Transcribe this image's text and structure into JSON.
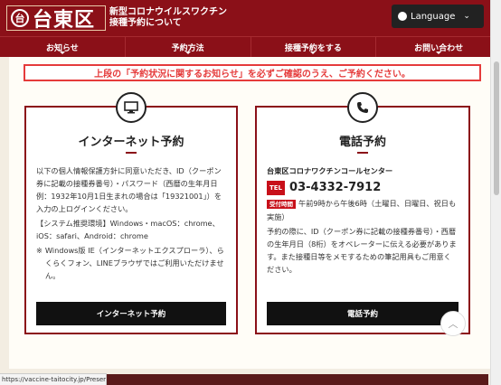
{
  "header": {
    "crest_glyph": "台",
    "city_name": "台東区",
    "site_title_line1": "新型コロナウイルスワクチン",
    "site_title_line2": "接種予約について",
    "language_label": "Language"
  },
  "nav": {
    "items": [
      {
        "label": "お知らせ"
      },
      {
        "label": "予約方法"
      },
      {
        "label": "接種予約をする"
      },
      {
        "label": "お問い合わせ"
      }
    ]
  },
  "notice": "上段の「予約状況に関するお知らせ」を必ずご確認のうえ、ご予約ください。",
  "internet": {
    "icon": "monitor-icon",
    "title": "インターネット予約",
    "body1": "以下の個人情報保護方針に同意いただき、ID（クーポン券に記載の接種券番号）・パスワード（西暦の生年月日例：1932年10月1日生まれの場合は「19321001」）を入力の上ログインください。",
    "body2": "【システム推奨環境】Windows・macOS：chrome、iOS：safari、Android：chrome",
    "note_mark": "※",
    "note": "Windows版 IE（インターネットエクスプローラ）、らくらくフォン、LINEブラウザではご利用いただけません。",
    "button": "インターネット予約"
  },
  "phone": {
    "icon": "phone-icon",
    "title": "電話予約",
    "call_center": "台東区コロナワクチンコールセンター",
    "tel_badge": "TEL",
    "tel_number": "03-4332-7912",
    "hours_badge": "受付時間",
    "hours": "午前9時から午後6時（土曜日、日曜日、祝日も実施）",
    "body": "予約の際に、ID（クーポン券に記載の接種券番号）・西暦の生年月日（8桁）をオペレーターに伝える必要があります。また接種日等をメモするための筆記用具もご用意ください。",
    "button": "電話予約"
  },
  "status_url": "https://vaccine-taitocity.jp/Preserve"
}
